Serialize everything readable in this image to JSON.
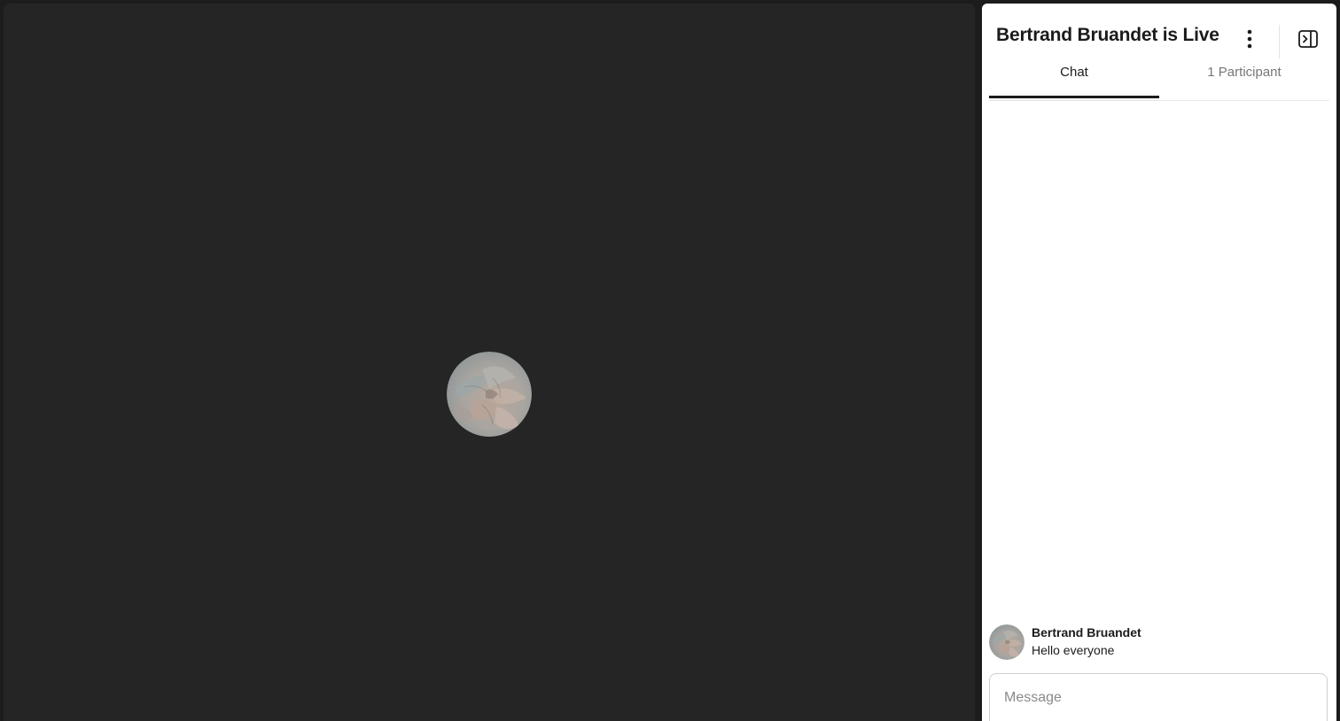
{
  "stream": {
    "host_avatar_icon": "succulent-avatar-image"
  },
  "panel": {
    "title": "Bertrand Bruandet is Live",
    "more_icon": "vertical-ellipsis-icon",
    "collapse_icon": "collapse-panel-icon",
    "tabs": [
      {
        "label": "Chat",
        "active": true
      },
      {
        "label": "1 Participant",
        "active": false
      }
    ]
  },
  "chat": {
    "messages": [
      {
        "author": "Bertrand Bruandet",
        "text": "Hello everyone",
        "avatar_icon": "succulent-avatar-image"
      }
    ],
    "composer": {
      "placeholder": "Message",
      "value": ""
    }
  },
  "colors": {
    "stage_background": "#252525",
    "panel_background": "#ffffff",
    "active_tab_indicator": "#1b1b1b"
  }
}
